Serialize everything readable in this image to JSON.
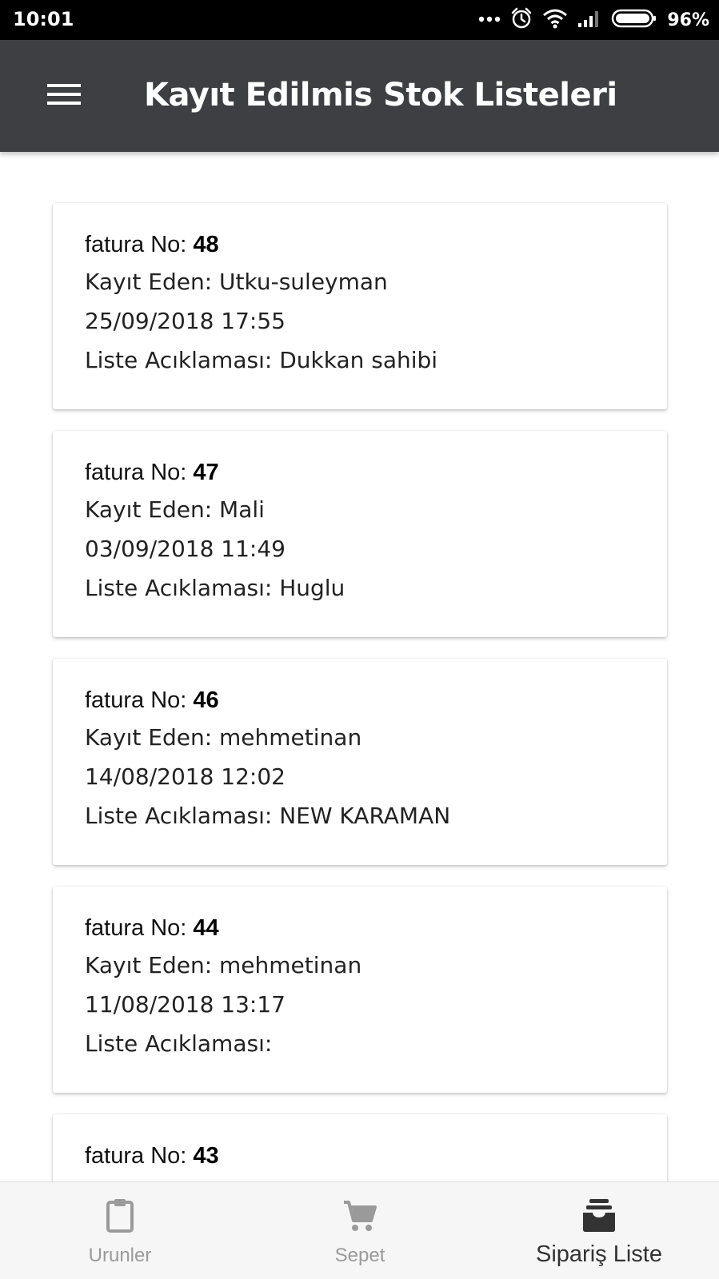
{
  "status_bar": {
    "time": "10:01",
    "battery": "96%",
    "icons": [
      "dots-icon",
      "alarm-icon",
      "wifi-icon",
      "signal-icon",
      "battery-icon"
    ]
  },
  "app_bar": {
    "title": "Kayıt Edilmis Stok Listeleri",
    "menu_icon": "hamburger-menu-icon"
  },
  "labels": {
    "invoice_prefix": "fatura No: ",
    "recorded_by_prefix": "Kayıt Eden: ",
    "description_prefix": "Liste Acıklaması: "
  },
  "cards": [
    {
      "invoice_no": "48",
      "recorded_by": "Utku-suleyman",
      "datetime": "25/09/2018 17:55",
      "description": "Dukkan sahibi"
    },
    {
      "invoice_no": "47",
      "recorded_by": "Mali",
      "datetime": "03/09/2018 11:49",
      "description": "Huglu"
    },
    {
      "invoice_no": "46",
      "recorded_by": "mehmetinan",
      "datetime": "14/08/2018 12:02",
      "description": "NEW KARAMAN"
    },
    {
      "invoice_no": "44",
      "recorded_by": "mehmetinan",
      "datetime": "11/08/2018 13:17",
      "description": ""
    },
    {
      "invoice_no": "43"
    }
  ],
  "bottom_nav": {
    "items": [
      {
        "label": "Urunler",
        "icon": "clipboard-icon",
        "active": false
      },
      {
        "label": "Sepet",
        "icon": "cart-icon",
        "active": false
      },
      {
        "label": "Sipariş Liste",
        "icon": "inbox-stack-icon",
        "active": true
      }
    ]
  },
  "colors": {
    "app_bar": "#3e3f43",
    "status_bar": "#000000",
    "nav_background": "#f6f6f6",
    "nav_inactive": "#9a9a9a",
    "nav_active": "#333333"
  }
}
